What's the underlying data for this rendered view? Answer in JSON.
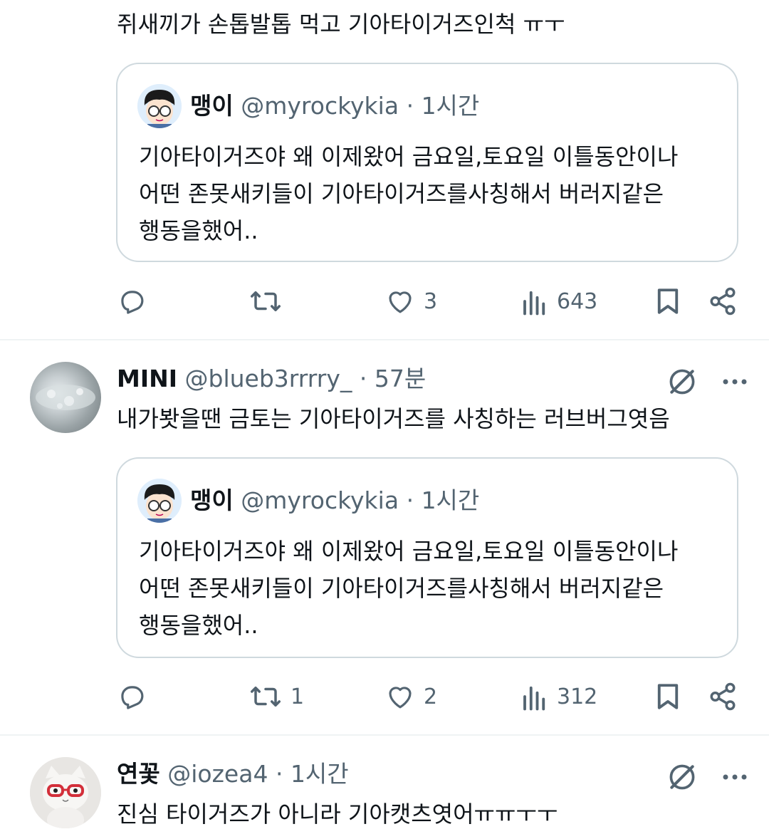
{
  "post1": {
    "text": "쥐새끼가 손톱발톱 먹고 기아타이거즈인척 ㅠㅜ",
    "quote": {
      "name": "맹이",
      "handle": "@myrockykia",
      "dot": "·",
      "time": "1시간",
      "lines": [
        "기아타이거즈야 왜 이제왔어 금요일,토요일 이틀동안이나",
        "어떤 존못새키들이 기아타이거즈를사칭해서 버러지같은",
        "행동을했어.."
      ]
    },
    "actions": {
      "replies": "",
      "reposts": "",
      "likes": "3",
      "views": "643"
    }
  },
  "post2": {
    "name": "MINI",
    "handle": "@blueb3rrrry_",
    "dot": "·",
    "time": "57분",
    "text": "내가봣을땐 금토는 기아타이거즈를 사칭하는 러브버그엿음",
    "quote": {
      "name": "맹이",
      "handle": "@myrockykia",
      "dot": "·",
      "time": "1시간",
      "lines": [
        "기아타이거즈야 왜 이제왔어 금요일,토요일 이틀동안이나",
        "어떤 존못새키들이 기아타이거즈를사칭해서 버러지같은",
        "행동을했어.."
      ]
    },
    "actions": {
      "replies": "",
      "reposts": "1",
      "likes": "2",
      "views": "312"
    }
  },
  "post3": {
    "name": "연꽃",
    "handle": "@iozea4",
    "dot": "·",
    "time": "1시간",
    "text": "진심 타이거즈가 아니라 기아캣츠엿어ㅠㅠㅜㅜ"
  },
  "icons": {
    "reply": "reply-icon",
    "repost": "repost-icon",
    "like": "heart-icon",
    "views": "views-icon",
    "bookmark": "bookmark-icon",
    "share": "share-icon",
    "grok": "grok-icon",
    "more": "more-icon"
  },
  "colors": {
    "text": "#0f1419",
    "secondary": "#536471",
    "border": "#cfd9de",
    "divider": "#eff3f4"
  }
}
